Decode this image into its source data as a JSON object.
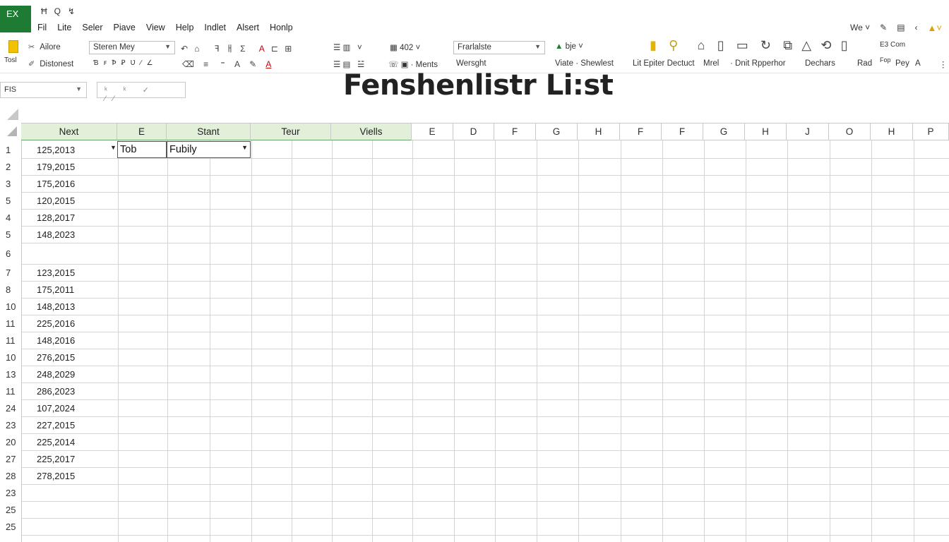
{
  "app": {
    "logo": "EX"
  },
  "qat": [
    "Ħ",
    "Q",
    "↯"
  ],
  "menu": [
    "Fil",
    "Lite",
    "Seler",
    "Piave",
    "View",
    "Help",
    "Indlet",
    "Alsert",
    "Honlp"
  ],
  "top_right": {
    "we": "We ˅",
    "warn": "▲˅"
  },
  "ribbon": {
    "paste_label": "Tosl",
    "row1": {
      "a": "Ailore",
      "font_name": "Steren Mey",
      "number_format": "402",
      "style_box": "Frarlalste",
      "bje": "bje",
      "right_a": "Com",
      "right_b": "E3"
    },
    "row2": {
      "a": "Distonest",
      "ments": "Ments",
      "weight": "Wersght",
      "viate": "Viate · Shewlest",
      "lit": "Lit Epiter Dectuct",
      "mrel": "Mrel",
      "dnit": "· Dnit Rpperhor",
      "dechars": "Dechars",
      "rad": "Rad",
      "pay": "Pey",
      "fop": "Fop",
      "a_end": "A"
    }
  },
  "name_box": {
    "value": "FIS"
  },
  "fx_box": {
    "value": "ᵏ ᵏ ✓ ⁄⁄"
  },
  "sheet_title": "Fenshenlistr Li:st",
  "columns": [
    "Next",
    "E",
    "Stant",
    "Teur",
    "Viells",
    "E",
    "D",
    "F",
    "G",
    "H",
    "F",
    "F",
    "G",
    "H",
    "J",
    "O",
    "H",
    "P"
  ],
  "row_numbers": [
    "1",
    "2",
    "3",
    "5",
    "4",
    "5",
    "6",
    "7",
    "8",
    "10",
    "11",
    "11",
    "10",
    "13",
    "11",
    "24",
    "23",
    "20",
    "27",
    "28",
    "23",
    "25",
    "25"
  ],
  "cells": {
    "col_a": [
      "125,2013",
      "179,2015",
      "175,2016",
      "120,2015",
      "128,2017",
      "148,2023",
      "",
      "123,2015",
      "175,2011",
      "148,2013",
      "225,2016",
      "148,2016",
      "276,2015",
      "248,2029",
      "286,2023",
      "107,2024",
      "227,2015",
      "225,2014",
      "225,2017",
      "278,2015",
      "",
      "",
      ""
    ],
    "b1": "Tob",
    "c1": "Fubily"
  },
  "colors": {
    "accent_green": "#1e7b34",
    "header_highlight": "#e2f0d9"
  }
}
